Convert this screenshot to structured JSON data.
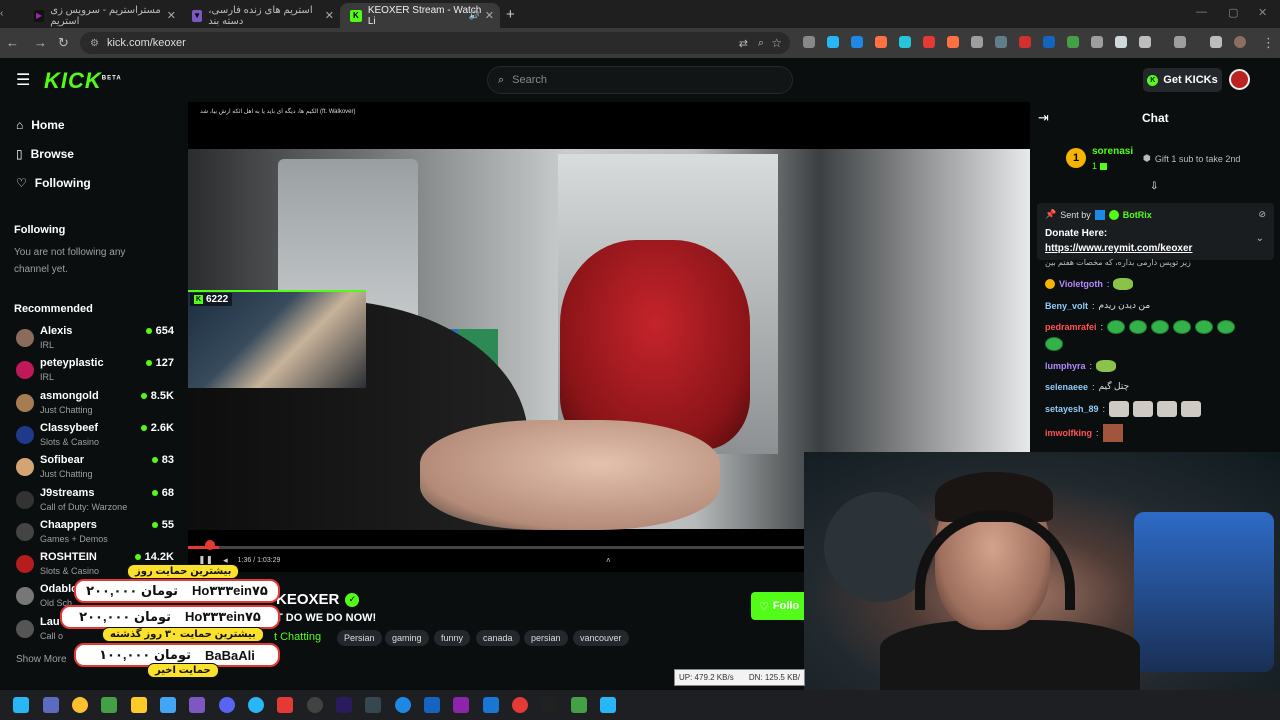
{
  "browser": {
    "tabs": [
      {
        "title": "مستراستریم - سرویس زی استریم",
        "active": false
      },
      {
        "title": "استریم های زنده فارسی، دسته بند",
        "active": false
      },
      {
        "title": "KEOXER Stream - Watch Li",
        "active": true
      }
    ],
    "url": "kick.com/keoxer"
  },
  "kick": {
    "search_placeholder": "Search",
    "get_kicks": "Get KICKs",
    "logo": "KICK",
    "logo_beta": "BETA"
  },
  "sidebar": {
    "nav": [
      "Home",
      "Browse",
      "Following"
    ],
    "following_header": "Following",
    "following_empty": "You are not following any channel yet.",
    "recommended_header": "Recommended",
    "recommended": [
      {
        "name": "Alexis",
        "category": "IRL",
        "viewers": "654",
        "color": "#8b6b5a"
      },
      {
        "name": "peteyplastic",
        "category": "IRL",
        "viewers": "127",
        "color": "#c2185b"
      },
      {
        "name": "asmongold",
        "category": "Just Chatting",
        "viewers": "8.5K",
        "color": "#a67c52"
      },
      {
        "name": "Classybeef",
        "category": "Slots & Casino",
        "viewers": "2.6K",
        "color": "#1e3a8a"
      },
      {
        "name": "Sofibear",
        "category": "Just Chatting",
        "viewers": "83",
        "color": "#d4a574"
      },
      {
        "name": "J9streams",
        "category": "Call of Duty: Warzone",
        "viewers": "68",
        "color": "#333333"
      },
      {
        "name": "Chaappers",
        "category": "Games + Demos",
        "viewers": "55",
        "color": "#444444"
      },
      {
        "name": "ROSHTEIN",
        "category": "Slots & Casino",
        "viewers": "14.2K",
        "color": "#b71c1c"
      },
      {
        "name": "Odablo",
        "category": "Old Sch",
        "viewers": "",
        "color": "#777777"
      },
      {
        "name": "Lau",
        "category": "Call o",
        "viewers": "",
        "color": "#555555"
      }
    ],
    "show_more": "Show More"
  },
  "player": {
    "viewer_count": "6222",
    "progress_fraction": 0.05,
    "time_readout": "1:36 / 1:03:29",
    "video_caption": "الکیم ها، دیگه ای باید یا به اهل ائکه ارش بیا، شد (ft. Walkover)"
  },
  "stream": {
    "streamer": "KEOXER",
    "title": "T DO WE DO NOW!",
    "category": "t Chatting",
    "tags": [
      "Persian",
      "gaming",
      "funny",
      "canada",
      "persian",
      "vancouver"
    ],
    "follow_label": "Follo"
  },
  "chat": {
    "header": "Chat",
    "top_gifter": {
      "name": "sorenasi",
      "count": "1",
      "rank": "1"
    },
    "gift_text": "Gift 1 sub to take 2nd",
    "pinned": {
      "sent_by": "Sent by",
      "bot": "BotRix",
      "line1": "Donate Here:",
      "link": "https://www.reymit.com/keoxer"
    },
    "partial_line": "زیر توپس دارمی بداره، که مخصات هفتم بین",
    "messages": [
      {
        "user": "Violetgoth",
        "text": "",
        "color": "#b388ff"
      },
      {
        "user": "Beny_volt",
        "text": "من دیدن ریدم",
        "color": "#90caf9"
      },
      {
        "user": "pedramrafei",
        "text": "",
        "color": "#ff5252"
      },
      {
        "user": "lumphyra",
        "text": "",
        "color": "#b388ff"
      },
      {
        "user": "selenaeee",
        "text": "چتل گیم",
        "color": "#90caf9"
      },
      {
        "user": "setayesh_89",
        "text": "",
        "color": "#90caf9"
      },
      {
        "user": "imwolfking",
        "text": "",
        "color": "#ff5252"
      }
    ]
  },
  "donations": {
    "top_label": "بیشترین حمایت روز",
    "mid_label": "بیشترین حمایت ۳۰ روز گذشته",
    "bottom_label": "حمایت اخیر",
    "rows": [
      {
        "name": "Ho۳۳۳ein۷۵",
        "amount": "۲۰۰,۰۰۰ تومان"
      },
      {
        "name": "Ho۳۳۳ein۷۵",
        "amount": "۲۰۰,۰۰۰ تومان"
      },
      {
        "name": "BaBaAli",
        "amount": "۱۰۰,۰۰۰ تومان"
      }
    ]
  },
  "netstats": {
    "up": "UP: 479.2 KB/s",
    "dn": "DN: 125.5 KB/"
  }
}
